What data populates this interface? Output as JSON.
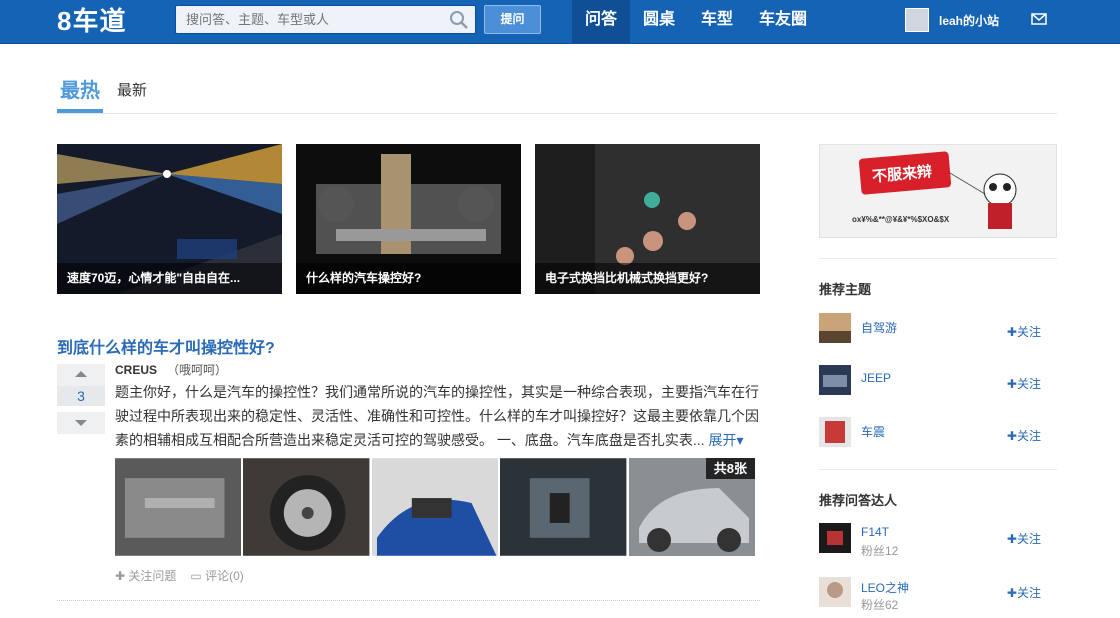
{
  "header": {
    "logo": "8车道",
    "search_placeholder": "搜问答、主题、车型或人",
    "ask_label": "提问",
    "nav": [
      "问答",
      "圆桌",
      "车型",
      "车友圈"
    ],
    "username": "leah的小站"
  },
  "tabs": [
    "最热",
    "最新"
  ],
  "featured": [
    {
      "caption": "速度70迈，心情才能\"自由自在..."
    },
    {
      "caption": "什么样的汽车操控好?"
    },
    {
      "caption": "电子式换挡比机械式换挡更好?"
    }
  ],
  "question": {
    "title": "到底什么样的车才叫操控性好?",
    "votes": "3",
    "author": "CREUS",
    "author_note": "（哦呵呵）",
    "body": "题主你好，什么是汽车的操控性？我们通常所说的汽车的操控性，其实是一种综合表现，主要指汽车在行驶过程中所表现出来的稳定性、灵活性、准确性和可控性。什么样的车才叫操控好？这最主要依靠几个因素的相辅相成互相配合所营造出来稳定灵活可控的驾驶感受。 一、底盘。汽车底盘是否扎实表...",
    "expand": "展开",
    "image_count": "共8张",
    "follow": "关注问题",
    "comment": "评论(0)"
  },
  "sidebar": {
    "ad_text": "不服来辩",
    "ad_sub": "ox¥%&**@¥&¥*%$XO&$X",
    "topics_title": "推荐主题",
    "topics": [
      {
        "name": "自驾游",
        "follow": "关注"
      },
      {
        "name": "JEEP",
        "follow": "关注"
      },
      {
        "name": "车震",
        "follow": "关注"
      }
    ],
    "experts_title": "推荐问答达人",
    "experts": [
      {
        "name": "F14T",
        "fans": "粉丝12",
        "follow": "关注"
      },
      {
        "name": "LEO之神",
        "fans": "粉丝62",
        "follow": "关注"
      }
    ]
  }
}
